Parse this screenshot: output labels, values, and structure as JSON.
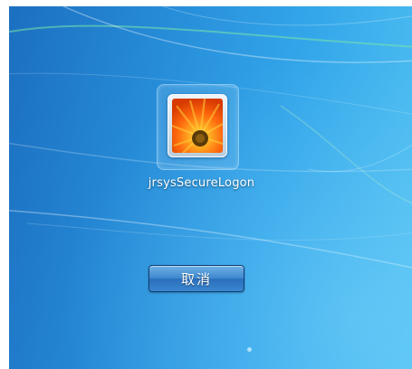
{
  "user": {
    "name": "jrsysSecureLogon",
    "avatar_icon": "orange-gerbera-flower"
  },
  "actions": {
    "cancel_label": "取消"
  },
  "colors": {
    "background_dark": "#1c6fc0",
    "background_light": "#52c2f2",
    "button_blue": "#3f88cf"
  }
}
